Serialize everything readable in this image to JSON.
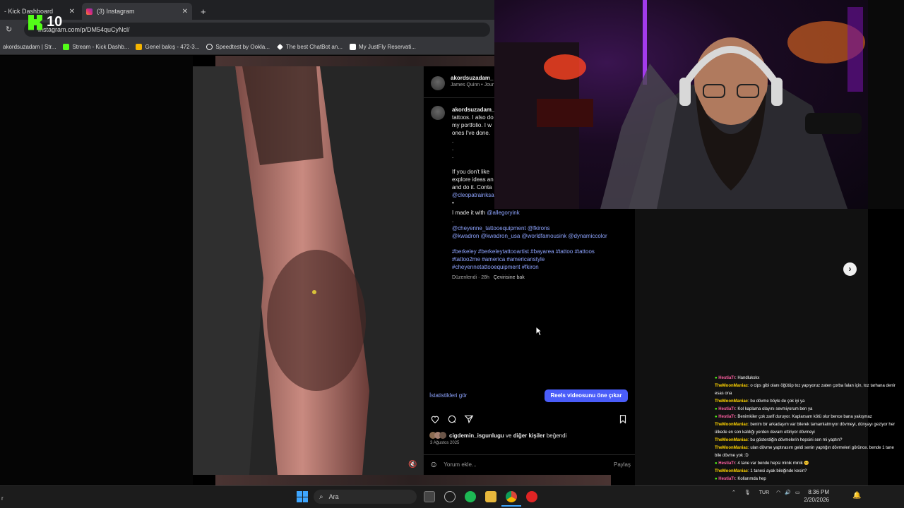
{
  "browser": {
    "tabs": [
      {
        "label": "- Kick Dashboard",
        "active": false
      },
      {
        "label": "(3) Instagram",
        "active": true
      }
    ],
    "new_tab": "+",
    "url": "instagram.com/p/DM54quCyNcl/",
    "bookmarks": [
      {
        "label": "akordsuzadam | Str...",
        "color": "#9146ff"
      },
      {
        "label": "Stream - Kick Dashb...",
        "color": "#53fc18"
      },
      {
        "label": "Genel bakış - 472-3...",
        "color": "#f4b400"
      },
      {
        "label": "Speedtest by Ookla...",
        "color": "#ffffff"
      },
      {
        "label": "The best ChatBot an...",
        "color": "#ffffff"
      },
      {
        "label": "My JustFly Reservati...",
        "color": "#ffffff"
      }
    ]
  },
  "overlay": {
    "kick_logo": "K",
    "kick_count": "10"
  },
  "post": {
    "header_user": "akordsuzadam_",
    "header_sub": "James Quinn • Jour",
    "caption_user": "akordsuzadam_",
    "caption_lines_1": [
      "tattoos. I also do",
      "my portfolio. I w",
      "ones I've done.",
      ".",
      ".",
      "."
    ],
    "caption_lines_2": [
      "If you don't like",
      "explore ideas an",
      "and do it. Conta"
    ],
    "caption_link_cleo": "@cleopatrainksa",
    "caption_bullet": "•",
    "made_it_with": "I made it with",
    "made_it_link": "@allegoryink",
    "dot": ".",
    "mentions_1": "@cheyenne_tattooequipment @fkirons",
    "mentions_2": "@kwadron @kwadron_usa @worldfamousink @dynamiccolor",
    "hashtags_1": "#berkeley #berkeleytattooartist #bayarea #tattoo #tattoos",
    "hashtags_2": "#tattoo2me #america #americanstyle",
    "hashtags_3": "#cheyennetattooequipment #fkiron",
    "edited": "Düzenlendi · 28h",
    "translate": "Çevirisine bak",
    "stats_link": "İstatistikleri gör",
    "boost_button": "Reels videosunu öne çıkar",
    "liked_by_user": "cigdemin_isgunlugu",
    "liked_by_and": "ve",
    "liked_by_others": "diğer kişiler",
    "liked_by_suffix": "beğendi",
    "date": "3 Ağustos 2025",
    "comment_placeholder": "Yorum ekle...",
    "share": "Paylaş"
  },
  "chat": [
    {
      "user": "HestiaTr",
      "color": "#ff5fa2",
      "text": ": Handlukskx"
    },
    {
      "user": "TheMoonManiac",
      "color": "#ffd400",
      "text": ": o cips gibi olanı öğütüp toz yapıyoruz zaten çorba falan için, toz tarhana denir esas ona"
    },
    {
      "user": "TheMoonManiac",
      "color": "#ffd400",
      "text": ": bu dövme böyle de çok iyi ya"
    },
    {
      "user": "HestiaTr",
      "color": "#ff5fa2",
      "text": ": Kol kaplama olayını sevmiyorum ben ya"
    },
    {
      "user": "HestiaTr",
      "color": "#ff5fa2",
      "text": ": Benimkiler çok zarif duruyor. Kaplarsam kötü olur bence bana yakışmaz"
    },
    {
      "user": "TheMoonManiac",
      "color": "#ffd400",
      "text": ": benim bir arkadaşım var bilerek tamamlatmıyor dövmeyi, dünyayı geziyor her ülkede en son kaldığı yerden devam ettiriyor dövmeyi"
    },
    {
      "user": "TheMoonManiac",
      "color": "#ffd400",
      "text": ": bu gösterdiğin dövmelerin hepsini sen mi yaptın?"
    },
    {
      "user": "TheMoonManiac",
      "color": "#ffd400",
      "text": ": ulan dövme yaptırasım geldi senin yaptığın dövmeleri görünce. bende 1 tane bile dövme yok :D"
    },
    {
      "user": "HestiaTr",
      "color": "#ff5fa2",
      "text": ": 4 tane var bende hepsi minik minik 😊"
    },
    {
      "user": "TheMoonManiac",
      "color": "#ffd400",
      "text": ": 1 tanesi ayak bileğinde kesin?"
    },
    {
      "user": "HestiaTr",
      "color": "#ff5fa2",
      "text": ": Kollarımda hep"
    }
  ],
  "taskbar": {
    "search_placeholder": "Ara",
    "language": "TUR",
    "time": "8:36 PM",
    "date": "2/20/2026",
    "left_text": "r"
  }
}
